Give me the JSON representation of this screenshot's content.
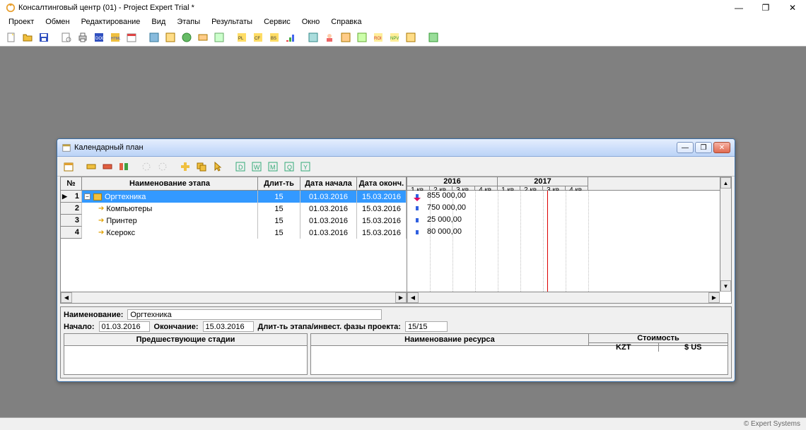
{
  "main_title": "Консалтинговый центр (01) - Project Expert Trial *",
  "menubar": [
    "Проект",
    "Обмен",
    "Редактирование",
    "Вид",
    "Этапы",
    "Результаты",
    "Сервис",
    "Окно",
    "Справка"
  ],
  "child_title": "Календарный план",
  "grid": {
    "headers": {
      "num": "№",
      "name": "Наименование этапа",
      "dur": "Длит-ть",
      "start": "Дата начала",
      "end": "Дата оконч."
    },
    "rows": [
      {
        "n": "1",
        "name": "Оргтехника",
        "dur": "15",
        "start": "01.03.2016",
        "end": "15.03.2016",
        "amount": "855 000,00",
        "selected": true,
        "marker": "▶",
        "expandable": true
      },
      {
        "n": "2",
        "name": "Компьютеры",
        "dur": "15",
        "start": "01.03.2016",
        "end": "15.03.2016",
        "amount": "750 000,00"
      },
      {
        "n": "3",
        "name": "Принтер",
        "dur": "15",
        "start": "01.03.2016",
        "end": "15.03.2016",
        "amount": "25 000,00"
      },
      {
        "n": "4",
        "name": "Ксерокс",
        "dur": "15",
        "start": "01.03.2016",
        "end": "15.03.2016",
        "amount": "80 000,00"
      }
    ]
  },
  "gantt": {
    "years": [
      "2016",
      "2017"
    ],
    "quarters": [
      "1 кв.",
      "2 кв.",
      "3 кв.",
      "4 кв.",
      "1 кв.",
      "2 кв.",
      "3 кв.",
      "4 кв."
    ]
  },
  "detail": {
    "name_lbl": "Наименование:",
    "name_val": "Оргтехника",
    "start_lbl": "Начало:",
    "start_val": "01.03.2016",
    "end_lbl": "Окончание:",
    "end_val": "15.03.2016",
    "dur_lbl": "Длит-ть этапа/инвест. фазы проекта:",
    "dur_val": "15/15",
    "left_header": "Предшествующие стадии",
    "right_header_main": "Наименование ресурса",
    "cost_header": "Стоимость",
    "cost_sub1": "KZT",
    "cost_sub2": "$ US"
  },
  "status": "© Expert Systems"
}
